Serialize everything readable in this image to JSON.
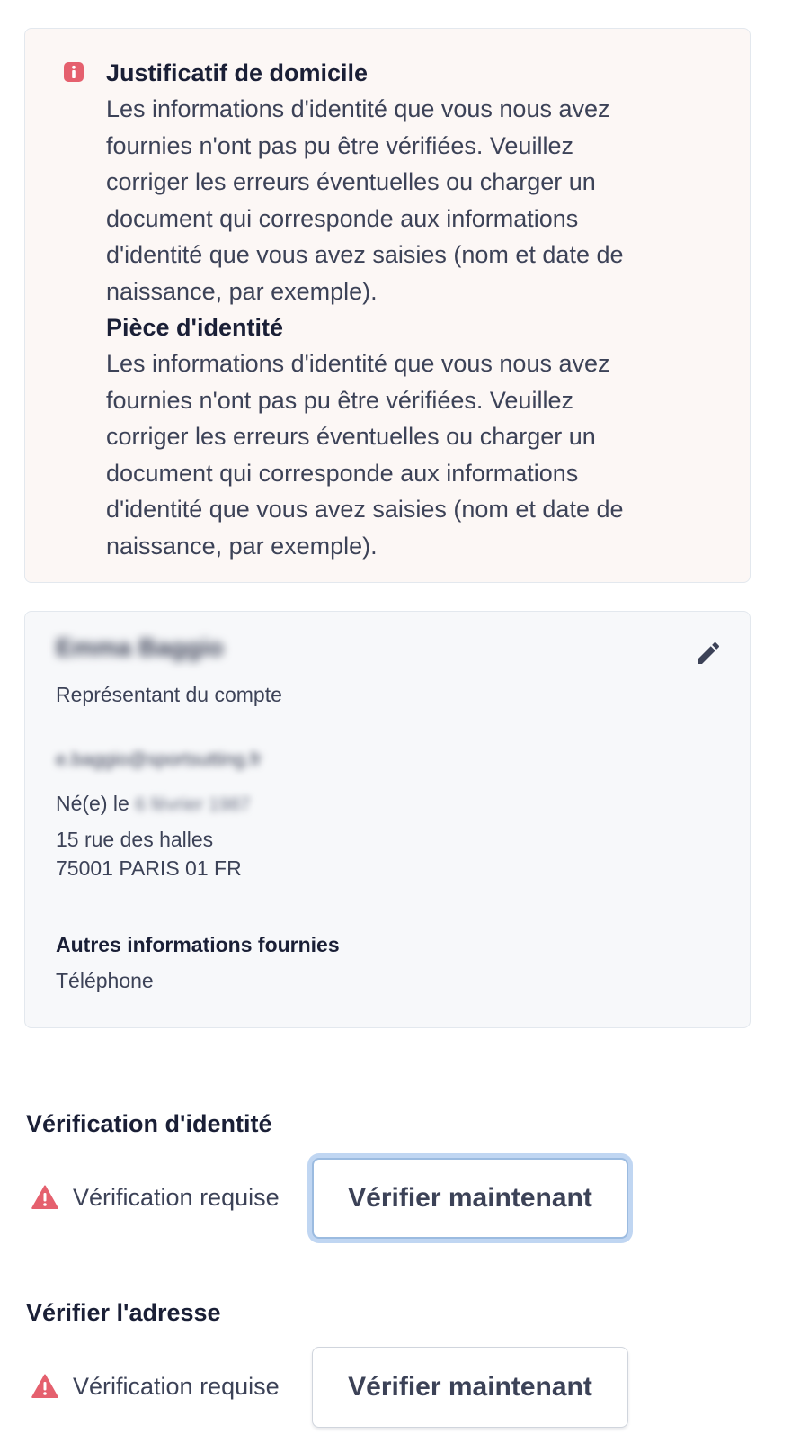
{
  "alert": {
    "icon": "info-icon",
    "icon_color": "#e5606e",
    "sections": [
      {
        "title": "Justificatif de domicile",
        "lines": [
          "Les informations d'identité que vous nous avez",
          "fournies n'ont pas pu être vérifiées. Veuillez",
          "corriger les erreurs éventuelles ou charger un",
          "document qui corresponde aux informations",
          "d'identité que vous avez saisies (nom et date de",
          "naissance, par exemple)."
        ]
      },
      {
        "title": "Pièce d'identité",
        "lines": [
          "Les informations d'identité que vous nous avez",
          "fournies n'ont pas pu être vérifiées. Veuillez",
          "corriger les erreurs éventuelles ou charger un",
          "document qui corresponde aux informations",
          "d'identité que vous avez saisies (nom et date de",
          "naissance, par exemple)."
        ]
      }
    ]
  },
  "person": {
    "name": "Emma Baggio",
    "role": "Représentant du compte",
    "email": "e.baggio@sportsutting.fr",
    "dob_label": "Né(e) le",
    "dob_value": "6 février 1987",
    "address_line1": "15 rue des halles",
    "address_line2": "75001 PARIS 01 FR",
    "other_info_title": "Autres informations fournies",
    "other_info_value": "Téléphone",
    "edit_icon": "pencil-icon"
  },
  "identity_verification": {
    "title": "Vérification d'identité",
    "status": "Vérification requise",
    "button": "Vérifier maintenant"
  },
  "address_verification": {
    "title": "Vérifier l'adresse",
    "status": "Vérification requise",
    "button": "Vérifier maintenant"
  },
  "colors": {
    "warning": "#e5606e",
    "focus_ring": "#a5c4ec"
  }
}
